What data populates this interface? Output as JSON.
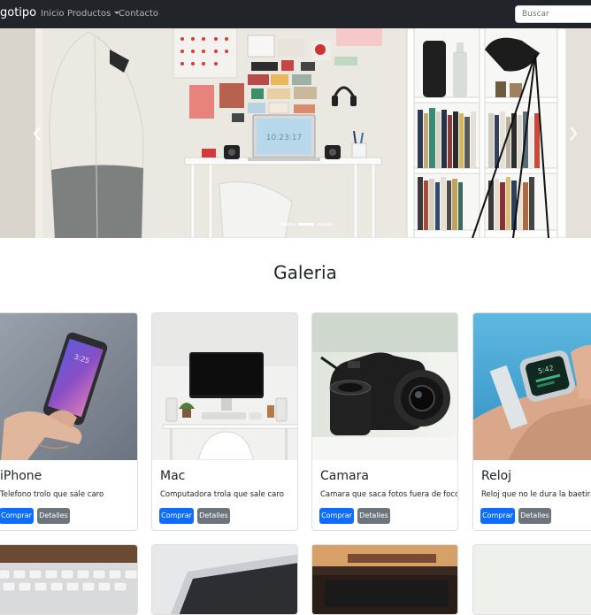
{
  "navbar": {
    "brand": "gotipo",
    "links": [
      "Inicio",
      "Productos",
      "Contacto"
    ],
    "search_placeholder": "Buscar"
  },
  "gallery": {
    "title": "Galeria",
    "cards": [
      {
        "title": "iPhone",
        "text": "Telefono trolo que sale caro",
        "buy_label": "Comprar",
        "details_label": "Detalles"
      },
      {
        "title": "Mac",
        "text": "Computadora trola que sale caro",
        "buy_label": "Comprar",
        "details_label": "Detalles"
      },
      {
        "title": "Camara",
        "text": "Camara que saca fotos fuera de foco",
        "buy_label": "Comprar",
        "details_label": "Detalles"
      },
      {
        "title": "Reloj",
        "text": "Reloj que no le dura la baetira",
        "buy_label": "Comprar",
        "details_label": "Detalles"
      }
    ]
  },
  "carousel": {
    "slide_count": 3,
    "active_index": 1,
    "screen_time": "10:23:17"
  },
  "colors": {
    "navbar_bg": "#212529",
    "primary": "#0d6efd",
    "secondary": "#6c757d"
  }
}
